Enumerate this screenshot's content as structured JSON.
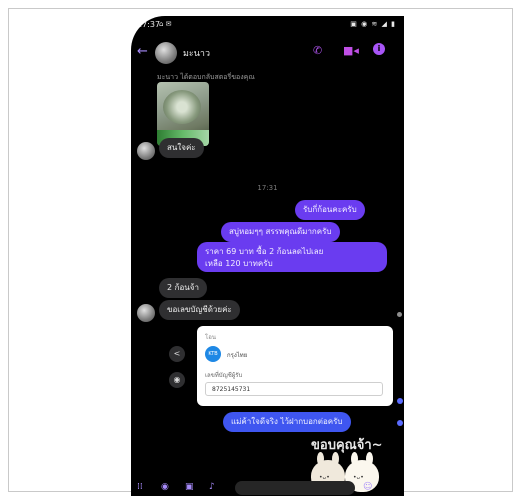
{
  "status": {
    "time": "17:37",
    "left_icons": "⌂ ✉",
    "right_icons": "▣ ◉ ≋ ◢ ▮"
  },
  "chat": {
    "contact_name": "มะนาว"
  },
  "messages": {
    "reply_note": "มะนาว ได้ตอบกลับสตอรี่ของคุณ",
    "m1": "สนใจค่ะ",
    "timestamp": "17:31",
    "m2": "รับกี่ก้อนคะครับ",
    "m3": "สบู่หอมๆๆ สรรพคุณดีมากครับ",
    "m4_line1": "ราคา 69 บาท ซื้อ 2 ก้อนลดไปเลย",
    "m4_line2": "เหลือ 120 บาทครับ",
    "m5": "2 ก้อนจ้า",
    "m6": "ขอเลขบัญชีด้วยค่ะ",
    "m7": "แม่ค้าใจดีจริง ไว้ฝากบอกต่อครับ"
  },
  "card": {
    "header": "โอน",
    "bank_name": "กรุงไทย",
    "account_label": "เลขที่บัญชีผู้รับ",
    "account_number": "8725145731"
  },
  "sticker": {
    "text": "ขอบคุณจ้า~"
  },
  "icons": {
    "back": "back-arrow-icon",
    "call": "phone-icon",
    "video": "video-icon",
    "info": "info-icon",
    "share": "share-icon",
    "camera": "camera-icon"
  },
  "colors": {
    "accent": "#a855f7",
    "outgoing": "#6a3cf0",
    "outgoing_alt": "#3f56f0",
    "incoming": "#2f2f31"
  }
}
